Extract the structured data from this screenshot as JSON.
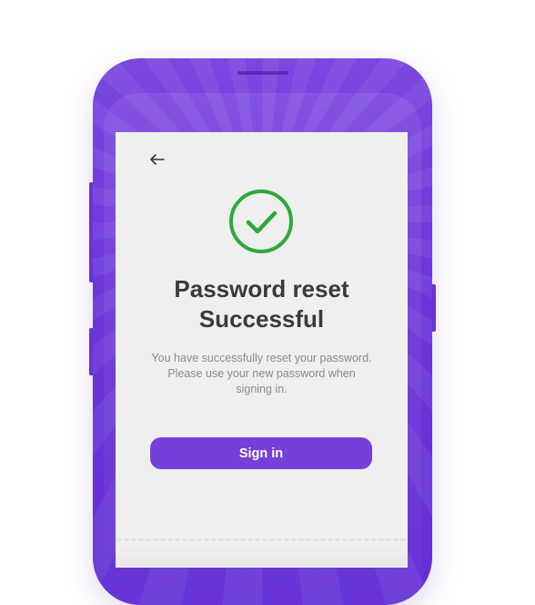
{
  "screen": {
    "title_line1": "Password reset",
    "title_line2": "Successful",
    "description_lines": [
      "You have successfully reset your password.",
      "Please use your new password when",
      "signing in."
    ],
    "primary_button_label": "Sign in"
  },
  "icons": {
    "back": "back-arrow-icon",
    "success": "check-circle-icon"
  },
  "colors": {
    "phone_body": "#6a36d9",
    "button": "#7440d9",
    "success": "#2fa83a",
    "title": "#3a3a3a",
    "body_text": "#8a8a8a",
    "screen_bg": "#efefef"
  }
}
